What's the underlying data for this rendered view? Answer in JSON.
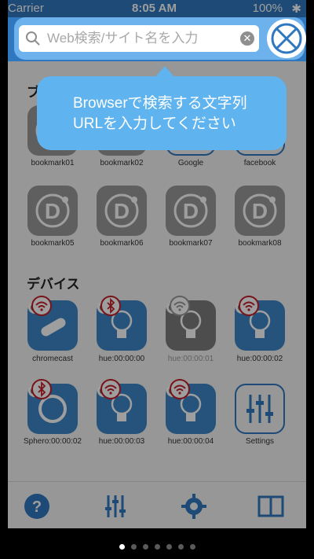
{
  "status_bar": {
    "carrier": "Carrier",
    "time": "8:05 AM",
    "battery": "100%"
  },
  "search": {
    "placeholder": "Web検索/サイト名を入力",
    "clear_icon": "clear-icon"
  },
  "sections": {
    "bookmarks_title": "ブ",
    "devices_title": "デバイス"
  },
  "bookmarks": [
    {
      "label": "bookmark01"
    },
    {
      "label": "bookmark02"
    },
    {
      "label": "Google"
    },
    {
      "label": "facebook"
    },
    {
      "label": "bookmark05"
    },
    {
      "label": "bookmark06"
    },
    {
      "label": "bookmark07"
    },
    {
      "label": "bookmark08"
    }
  ],
  "devices": [
    {
      "label": "chromecast",
      "connection": "wifi"
    },
    {
      "label": "hue:00:00:00",
      "connection": "bluetooth"
    },
    {
      "label": "hue:00:00:01",
      "connection": "wifi"
    },
    {
      "label": "hue:00:00:02",
      "connection": "wifi"
    },
    {
      "label": "Sphero:00:00:02",
      "connection": "bluetooth"
    },
    {
      "label": "hue:00:00:03",
      "connection": "wifi"
    },
    {
      "label": "hue:00:00:04",
      "connection": "wifi"
    },
    {
      "label": "Settings",
      "connection": ""
    }
  ],
  "tooltip": {
    "line1": "Browserで検索する文字列",
    "line2": "URLを入力してください"
  },
  "tabs": [
    {
      "icon": "help-icon"
    },
    {
      "icon": "sliders-icon"
    },
    {
      "icon": "gear-icon"
    },
    {
      "icon": "book-icon"
    }
  ],
  "pager": {
    "total": 7,
    "current": 1
  },
  "colors": {
    "brand_blue": "#2f78bf",
    "tooltip_blue": "#5fb3ee",
    "badge_red": "#c21f2b"
  }
}
